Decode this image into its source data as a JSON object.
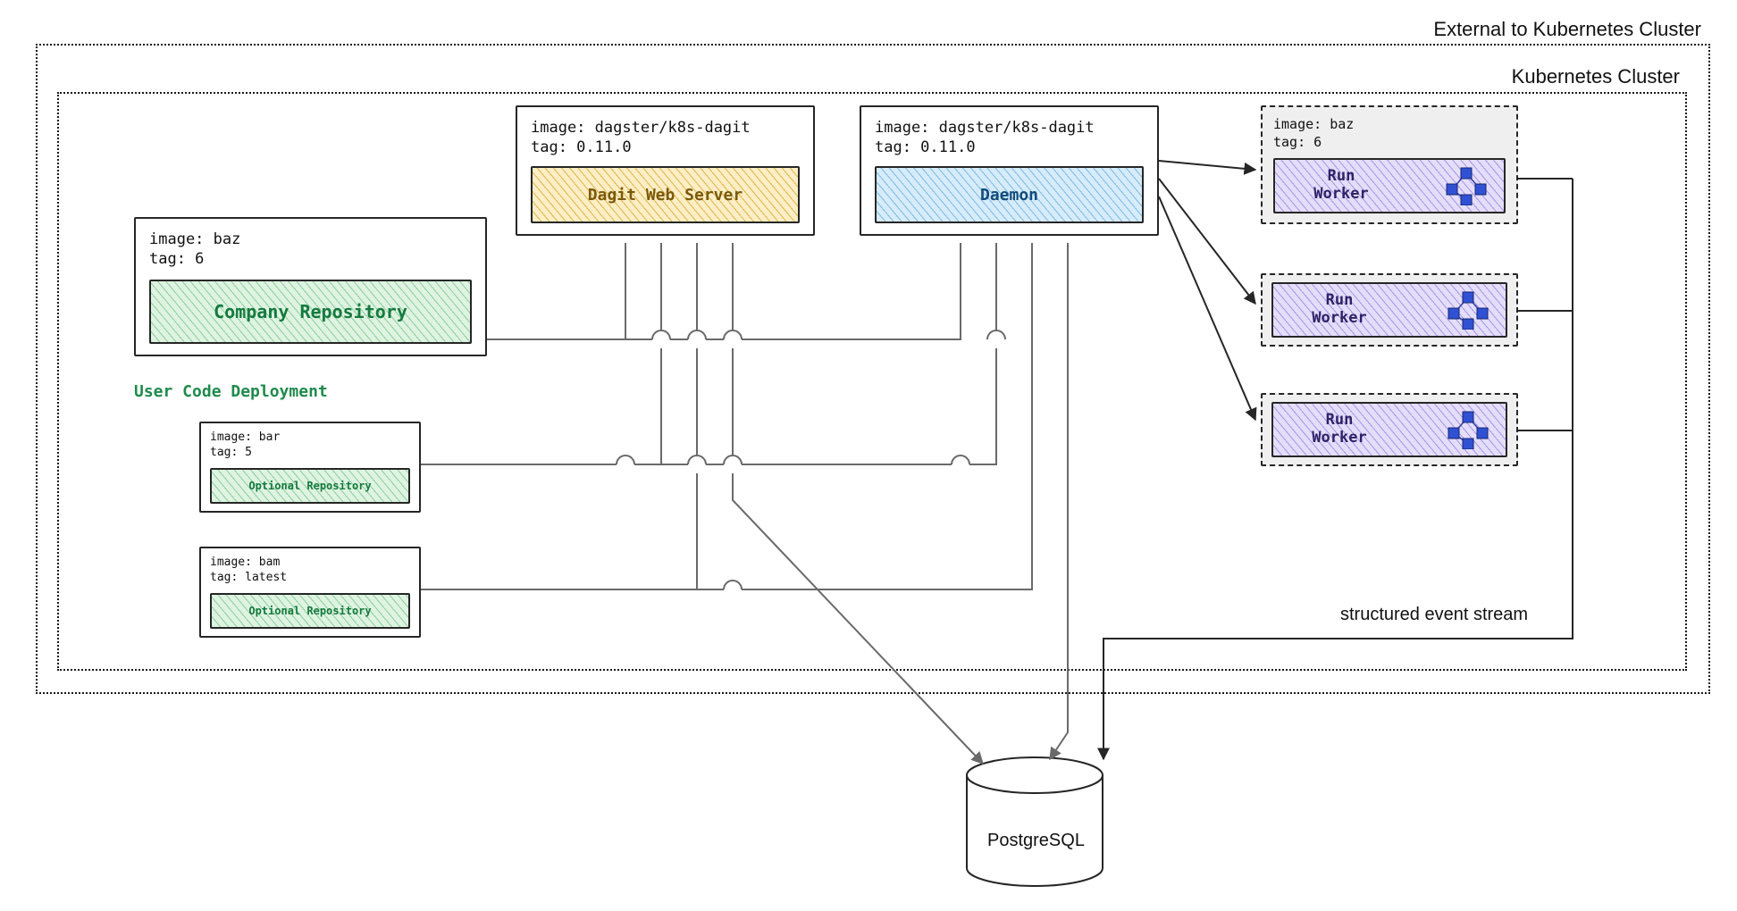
{
  "outer_label": "External to Kubernetes Cluster",
  "inner_label": "Kubernetes Cluster",
  "company_repo": {
    "image_line": "image: baz",
    "tag_line": "tag: 6",
    "title": "Company Repository"
  },
  "ucd_label": "User Code Deployment",
  "opt_repo_1": {
    "image_line": "image: bar",
    "tag_line": "tag: 5",
    "title": "Optional Repository"
  },
  "opt_repo_2": {
    "image_line": "image: bam",
    "tag_line": "tag: latest",
    "title": "Optional Repository"
  },
  "dagit": {
    "image_line": "image: dagster/k8s-dagit",
    "tag_line": "tag: 0.11.0",
    "title": "Dagit Web Server"
  },
  "daemon": {
    "image_line": "image: dagster/k8s-dagit",
    "tag_line": "tag: 0.11.0",
    "title": "Daemon"
  },
  "run_worker_top": {
    "image_line": "image: baz",
    "tag_line": "tag: 6",
    "title": "Run\nWorker"
  },
  "run_worker_mid": {
    "title": "Run\nWorker"
  },
  "run_worker_bot": {
    "title": "Run\nWorker"
  },
  "event_stream_label": "structured event stream",
  "db_label": "PostgreSQL"
}
